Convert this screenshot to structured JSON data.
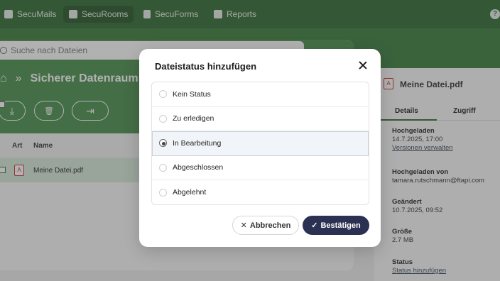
{
  "nav": {
    "items": [
      {
        "label": "SecuMails",
        "icon": "mail-icon"
      },
      {
        "label": "SecuRooms",
        "icon": "folder-icon"
      },
      {
        "label": "SecuForms",
        "icon": "document-icon"
      },
      {
        "label": "Reports",
        "icon": "chart-icon"
      }
    ],
    "help_icon": "?"
  },
  "search": {
    "placeholder": "Suche nach Dateien"
  },
  "breadcrumb": {
    "home_icon": "⌂",
    "separator": "»",
    "title": "Sicherer Datenraum"
  },
  "toolbar": {
    "download_icon": "⤓",
    "delete_icon": "🗑",
    "move_icon": "⇥"
  },
  "table": {
    "headers": [
      "Art",
      "Name"
    ],
    "rows": [
      {
        "name": "Meine Datei.pdf",
        "checked": true
      }
    ]
  },
  "details": {
    "file_name": "Meine Datei.pdf",
    "tabs": [
      "Details",
      "Zugriff"
    ],
    "fields": [
      {
        "label": "Hochgeladen",
        "value": "14.7.2025, 17:00",
        "link": "Versionen verwalten"
      },
      {
        "label": "Hochgeladen von",
        "value": "tamara.rutschmann@ftapi.com"
      },
      {
        "label": "Geändert",
        "value": "10.7.2025, 09:52"
      },
      {
        "label": "Größe",
        "value": "2.7 MB"
      },
      {
        "label": "Status",
        "link": "Status hinzufügen"
      }
    ]
  },
  "modal": {
    "title": "Dateistatus hinzufügen",
    "options": [
      "Kein Status",
      "Zu erledigen",
      "In Bearbeitung",
      "Abgeschlossen",
      "Abgelehnt"
    ],
    "selected_index": 2,
    "cancel_label": "Abbrechen",
    "confirm_label": "Bestätigen"
  },
  "colors": {
    "brand_green": "#2f6b32",
    "confirm_button": "#2b3152"
  }
}
